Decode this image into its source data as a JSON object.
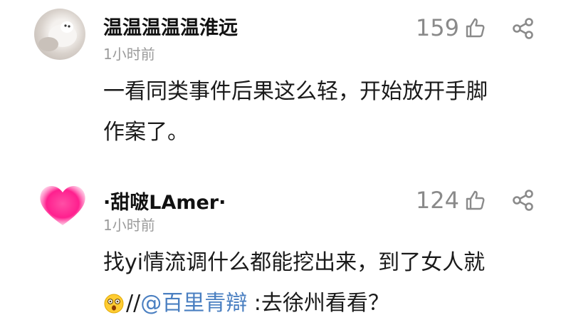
{
  "comments": [
    {
      "username": "温温温温温淮远",
      "time": "1小时前",
      "likes": "159",
      "text_lines": [
        "一看同类事件后果这么轻，开始放开手脚",
        "作案了。"
      ]
    },
    {
      "username": "·甜啵LAmer·",
      "time": "1小时前",
      "likes": "124",
      "text_line1": "找yi情流调什么都能挖出来，到了女人就",
      "text_line2_prefix": "//",
      "mention": "@百里青辯",
      "text_line2_suffix": " :去徐州看看？"
    }
  ],
  "icons": {
    "like": "thumbs-up-outline-icon",
    "share": "share-icon",
    "emoji": "astonished-face-emoji",
    "avatar2": "pink-heart"
  },
  "colors": {
    "mention": "#4a7fc1",
    "meta": "#9b9b9b",
    "heart": "#ff2d8a"
  }
}
